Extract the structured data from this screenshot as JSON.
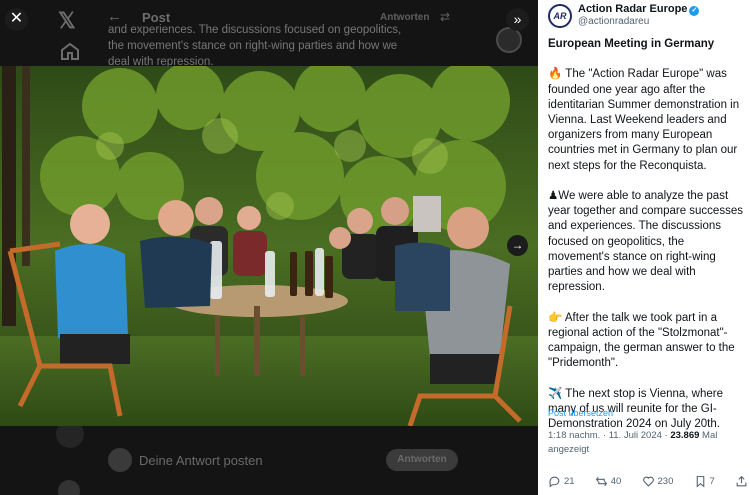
{
  "viewer": {
    "close_icon": "close-icon",
    "collapse_icon": "chevron-double-right-icon",
    "next_icon": "arrow-right-icon"
  },
  "background": {
    "back_arrow": "←",
    "title": "Post",
    "reply_tab": "Antworten",
    "text": "and experiences. The discussions focused on geopolitics, the movement's stance on right-wing parties and how we deal with repression.",
    "reply_placeholder": "Deine Antwort posten",
    "reply_button": "Antworten"
  },
  "tweet": {
    "author_name": "Action Radar Europe",
    "author_handle": "@actionradareu",
    "avatar_text": "AR",
    "paragraphs": [
      "European Meeting in Germany",
      "🔥 The \"Action Radar Europe\" was founded one year ago after the identitarian Summer demonstration in Vienna. Last Weekend leaders and organizers from many European countries met in Germany to plan our next steps for the Reconquista.",
      "♟We were able to analyze the past year together and compare successes and experiences. The discussions focused on geopolitics, the movement's stance on right-wing parties and how we deal with repression.",
      "👉 After the talk we took part in a regional action of the \"Stolzmonat\"-campaign, the german answer to the \"Pridemonth\".",
      "✈️ The next stop is Vienna, where many of us will reunite for the GI-Demonstration 2024 on July 20th."
    ],
    "translate_label": "Post übersetzen",
    "timestamp": "1:18 nachm. · 11. Juli 2024 · ",
    "views_count": "23.869",
    "views_label": " Mal angezeigt",
    "actions": {
      "replies": "21",
      "reposts": "40",
      "likes": "230",
      "bookmarks": "7"
    }
  }
}
